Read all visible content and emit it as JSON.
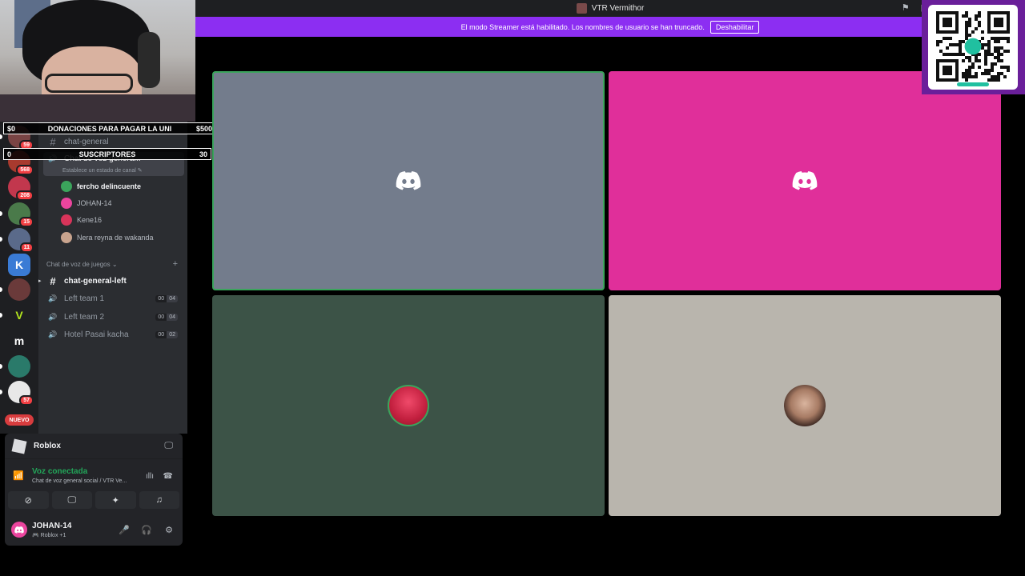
{
  "titlebar": {
    "title": "VTR Vermithor"
  },
  "banner": {
    "message": "El modo Streamer está habilitado. Los nombres de usuario se han truncado.",
    "button": "Deshabilitar"
  },
  "overlay": {
    "donations": {
      "left": "$0",
      "label": "DONACIONES PARA PAGAR LA UNI",
      "right": "$500"
    },
    "subs": {
      "left": "0",
      "label": "SUSCRIPTORES",
      "right": "30"
    }
  },
  "guilds": [
    {
      "badge": "59",
      "color": "#7a4444"
    },
    {
      "badge": "568",
      "color": "#a83a2e"
    },
    {
      "badge": "208",
      "color": "#c2374d"
    },
    {
      "badge": "15",
      "color": "#4a7a4a"
    },
    {
      "badge": "11",
      "color": "#5a6a8a"
    },
    {
      "text": "K",
      "color": "#3a7bd5"
    },
    {
      "badge": "",
      "color": "#6a3a3a"
    },
    {
      "text": "V",
      "color": "#1e1f22",
      "textColor": "#b4e61e"
    },
    {
      "text": "m",
      "color": "#1e1f22"
    },
    {
      "badge": "",
      "color": "#2a7a6a"
    },
    {
      "badge": "57",
      "color": "#e8e8e8"
    }
  ],
  "guild_new": "NUEVO",
  "channels": {
    "general": "chat-general",
    "voice_general": "Chat de voz genera...",
    "status_hint": "Establece un estado de canal ✎",
    "voice_users": [
      "fercho delincuente",
      "JOHAN-14",
      "Kene16",
      "Nera reyna de wakanda"
    ],
    "category": "Chat de voz de juegos ⌄",
    "category_plus": "+",
    "left_chat": "chat-general-left",
    "voice_channels": [
      {
        "name": "Left team 1",
        "a": "00",
        "b": "04"
      },
      {
        "name": "Left team 2",
        "a": "00",
        "b": "04"
      },
      {
        "name": "Hotel Pasai kacha",
        "a": "00",
        "b": "02"
      }
    ]
  },
  "activity": {
    "name": "Roblox"
  },
  "voice": {
    "status": "Voz conectada",
    "channel": "Chat de voz general social / VTR Ve..."
  },
  "user": {
    "name": "JOHAN-14",
    "sub": "🎮 Roblox +1"
  },
  "icons": {
    "hash": "#",
    "speaker": "🔊",
    "signal": "📶",
    "waveform": "ıllı",
    "hangup": "☎",
    "camera_off": "⊘",
    "screen": "🖵",
    "apps": "✦",
    "soundboard": "♫",
    "mic": "🎤",
    "headset": "🎧",
    "gear": "⚙",
    "flag": "⚑",
    "inbox": "▣",
    "chevron": "▸"
  },
  "colors": {
    "tile_gray": "#737c8c",
    "tile_pink": "#e02f9a",
    "tile_dark": "#3c5347",
    "tile_beige": "#b9b5ad",
    "speaking": "#3ba55c",
    "banner": "#8c2ef2"
  }
}
